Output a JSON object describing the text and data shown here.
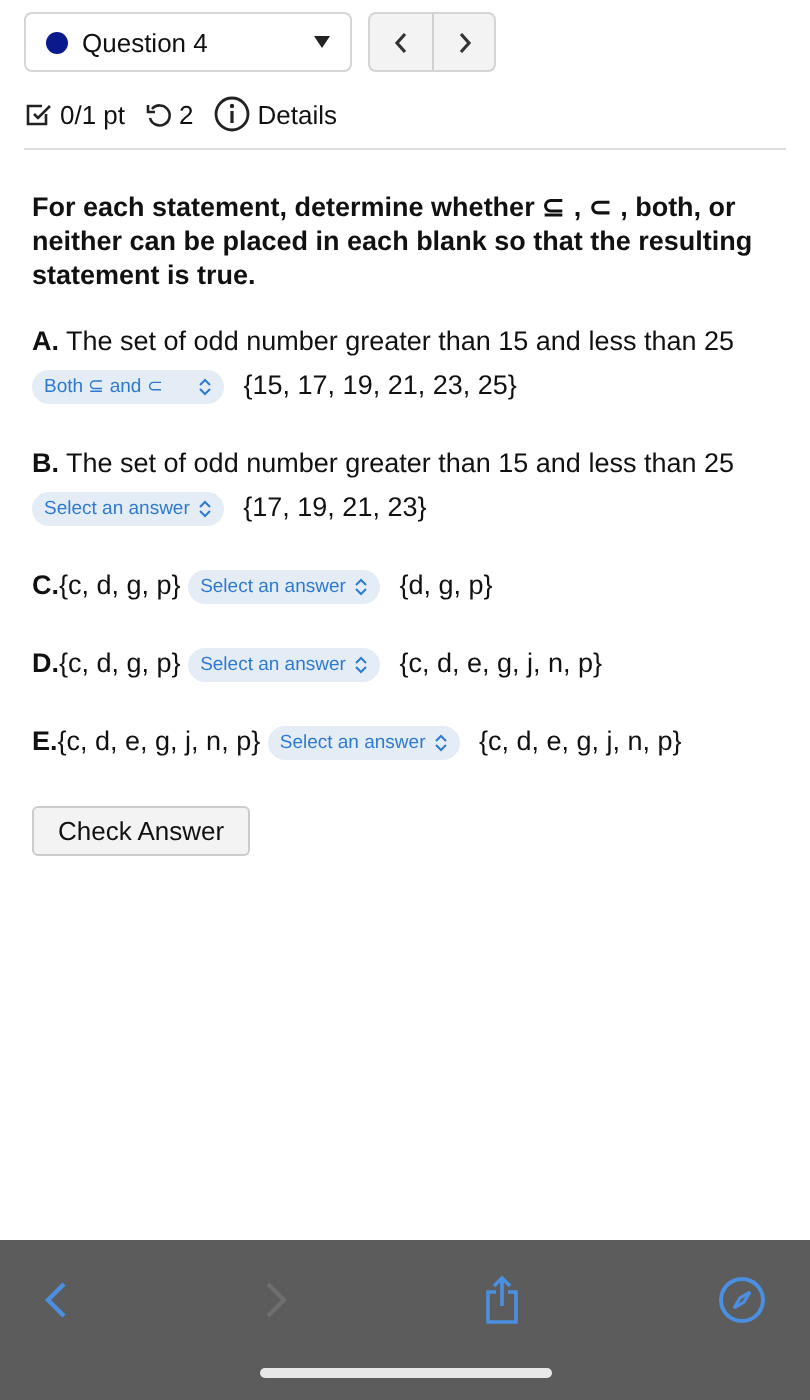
{
  "question_picker": {
    "label": "Question 4",
    "color": "#0a1a8c"
  },
  "meta": {
    "points": "0/1 pt",
    "attempts": "2",
    "details": "Details"
  },
  "instructions": "**For each statement, determine whether ⊆ , ⊂ , both, or neither can be placed in each blank so that the resulting statement is true.**",
  "statements": [
    {
      "label": "A.",
      "left": "The set of odd number greater than 15 and less than 25",
      "answer": "Both ⊆ and ⊂",
      "right": "{15, 17, 19, 21, 23, 25}"
    },
    {
      "label": "B.",
      "left": "The set of odd number greater than 15 and less than 25",
      "answer": "Select an answer",
      "right": "{17, 19, 21, 23}"
    },
    {
      "label": "C.",
      "left": "{c, d, g, p}",
      "answer": "Select an answer",
      "right": "{d, g, p}"
    },
    {
      "label": "D.",
      "left": "{c, d, g, p}",
      "answer": "Select an answer",
      "right": "{c, d, e, g, j, n, p}"
    },
    {
      "label": "E.",
      "left": "{c, d, e, g, j, n, p}",
      "answer": "Select an answer",
      "right": "{c, d, e, g, j, n, p}"
    }
  ],
  "check_button": "Check Answer",
  "browser_toolbar": {
    "back_disabled": false,
    "forward_disabled": true
  }
}
